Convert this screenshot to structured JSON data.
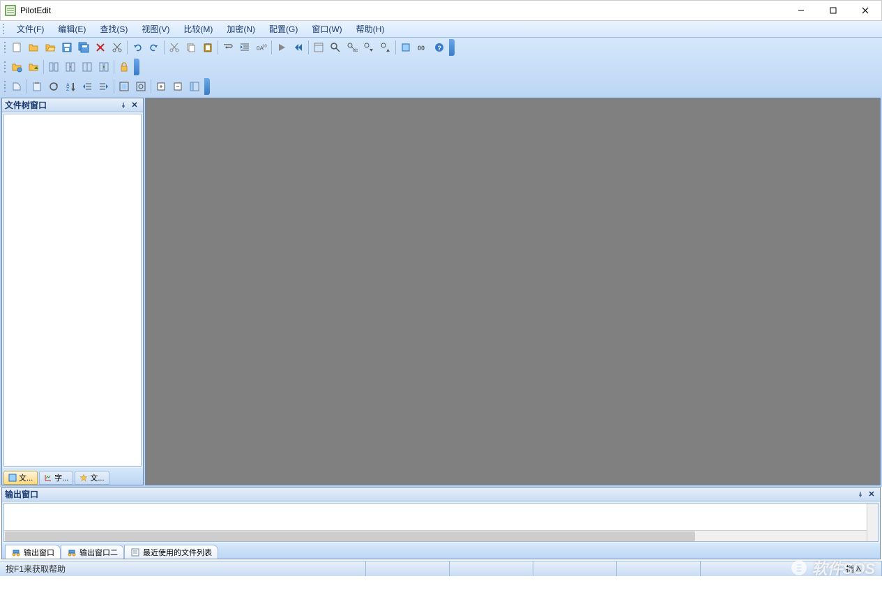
{
  "app": {
    "title": "PilotEdit"
  },
  "menu": {
    "file": "文件(F)",
    "edit": "编辑(E)",
    "search": "查找(S)",
    "view": "视图(V)",
    "compare": "比较(M)",
    "encrypt": "加密(N)",
    "config": "配置(G)",
    "window": "窗口(W)",
    "help": "帮助(H)"
  },
  "sidebar": {
    "title": "文件树窗口",
    "tabs": {
      "files": "文...",
      "chars": "字...",
      "fav": "文..."
    }
  },
  "output": {
    "title": "输出窗口",
    "tabs": {
      "out1": "输出窗口",
      "out2": "输出窗口二",
      "recent": "最近使用的文件列表"
    }
  },
  "status": {
    "help": "按F1来获取帮助",
    "mode": "插入"
  },
  "watermark": "软件SOS"
}
